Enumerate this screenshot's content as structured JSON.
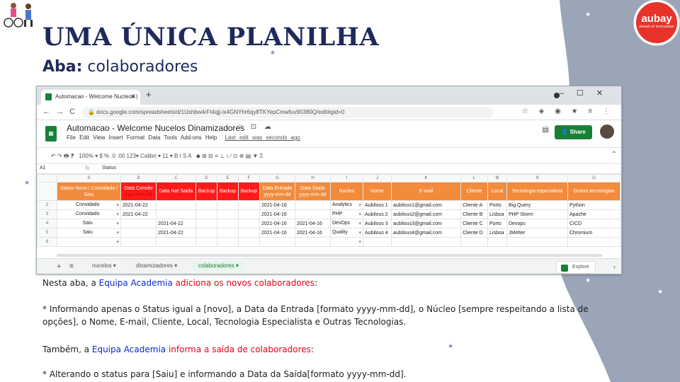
{
  "slide": {
    "title": "UMA ÚNICA PLANILHA",
    "subtitle_prefix": "Aba:",
    "subtitle_value": "colaboradores",
    "logo_name": "aubay",
    "logo_tagline": "ahead of innovation"
  },
  "browser": {
    "tab_title": "Automacao - Welcome Nucleos |",
    "url": "docs.google.com/spreadsheets/d/1Ushbw4rFt4qjj-ix4GNYhr6qy8TKYepCmwfuv90380Q/edit#gid=0",
    "doc_title": "Automacao - Welcome Nucelos Dinamizadores",
    "menu": [
      "File",
      "Edit",
      "View",
      "Insert",
      "Format",
      "Data",
      "Tools",
      "Add-ons",
      "Help"
    ],
    "last_edit": "Last edit was seconds ago",
    "share_label": "Share",
    "toolbar_zoom": "100%",
    "toolbar_font": "Calibri",
    "toolbar_size": "11",
    "toolbar_text": "100% ▾   $   %   .0   .00   123▾     Calibri      ▾     11    ▾   B   I   S   A",
    "cell_ref": "A1",
    "formula_value": "Status"
  },
  "sheet": {
    "columns": [
      "A",
      "B",
      "C",
      "D",
      "E",
      "F",
      "G",
      "H",
      "I",
      "J",
      "K",
      "L",
      "M",
      "N",
      "O"
    ],
    "headers": [
      {
        "text": "Status Novo / Convidado / Saiu",
        "color": "orange"
      },
      {
        "text": "Data Convite",
        "sub": "yyyy-mm-dd",
        "color": "red"
      },
      {
        "text": "Data Not Saida",
        "color": "red"
      },
      {
        "text": "Backup",
        "color": "red"
      },
      {
        "text": "Backup",
        "color": "red"
      },
      {
        "text": "Backup",
        "color": "red"
      },
      {
        "text": "Data Entrada yyyy-mm-dd",
        "color": "orange"
      },
      {
        "text": "Data Saida yyyy-mm-dd",
        "color": "orange"
      },
      {
        "text": "Nucleo",
        "color": "orange"
      },
      {
        "text": "Nome",
        "color": "orange"
      },
      {
        "text": "E-mail",
        "color": "orange"
      },
      {
        "text": "Cliente",
        "color": "orange"
      },
      {
        "text": "Local",
        "color": "orange"
      },
      {
        "text": "Tecnologia especialista",
        "color": "orange"
      },
      {
        "text": "Outras tecnologias",
        "color": "orange"
      }
    ],
    "rows": [
      [
        "Convidado",
        "2021-04-22",
        "",
        "",
        "",
        "",
        "2021-04-16",
        "",
        "Analytics",
        "Aubilous 1",
        "aubilous1@gmail.com",
        "Cliente A",
        "Porto",
        "Big Query",
        "Python"
      ],
      [
        "Convidado",
        "2021-04-22",
        "",
        "",
        "",
        "",
        "2021-04-16",
        "",
        "PHP",
        "Aubilous 2",
        "aubilous2@gmail.com",
        "Cliente B",
        "Lisboa",
        "PHP Storm",
        "Apache"
      ],
      [
        "Saiu",
        "",
        "2021-04-22",
        "",
        "",
        "",
        "2021-04-16",
        "2021-04-16",
        "DevOps",
        "Aubilous 3",
        "aubilous3@gmail.com",
        "Cliente C",
        "Porto",
        "Devops",
        "CICD"
      ],
      [
        "Saiu",
        "",
        "2021-04-22",
        "",
        "",
        "",
        "2021-04-16",
        "2021-04-16",
        "Quality",
        "Aubilous 4",
        "aubilous4@gmail.com",
        "Cliente D",
        "Lisboa",
        "JMetter",
        "Chromium"
      ],
      [
        "",
        "",
        "",
        "",
        "",
        "",
        "",
        "",
        "",
        "",
        "",
        "",
        "",
        "",
        ""
      ]
    ],
    "row_numbers": [
      "1",
      "2",
      "3",
      "4",
      "5",
      "6"
    ],
    "sheet_tabs": [
      "nucelos",
      "dinamizadores",
      "colaboradores"
    ],
    "active_tab": "colaboradores",
    "explore_label": "Explore"
  },
  "text": {
    "p1_a": "Nesta aba, a ",
    "p1_b": "Equipa Academia",
    "p1_c": " adiciona os novos colaboradores",
    "p1_d": ":",
    "p2": "* Informando apenas o Status igual a [novo], a Data da Entrada [formato yyyy-mm-dd], o Núcleo [sempre respeitando a lista de opções], o Nome, E-mail, Cliente, Local, Tecnologia Especialista e Outras Tecnologias.",
    "p3_a": "Também, a ",
    "p3_b": "Equipa Academia",
    "p3_c": " informa a saída de colaboradores",
    "p3_d": ":",
    "p4": "* Alterando o status para [Saiu] e informando a Data da Saída[formato yyyy-mm-dd]."
  },
  "colors": {
    "title": "#1f2a5c",
    "accent_blue": "#0c28c9",
    "accent_red": "#e8001a",
    "header_orange": "#f28b3c",
    "header_red": "#ff1a1a",
    "panel": "#9aa5b8"
  }
}
